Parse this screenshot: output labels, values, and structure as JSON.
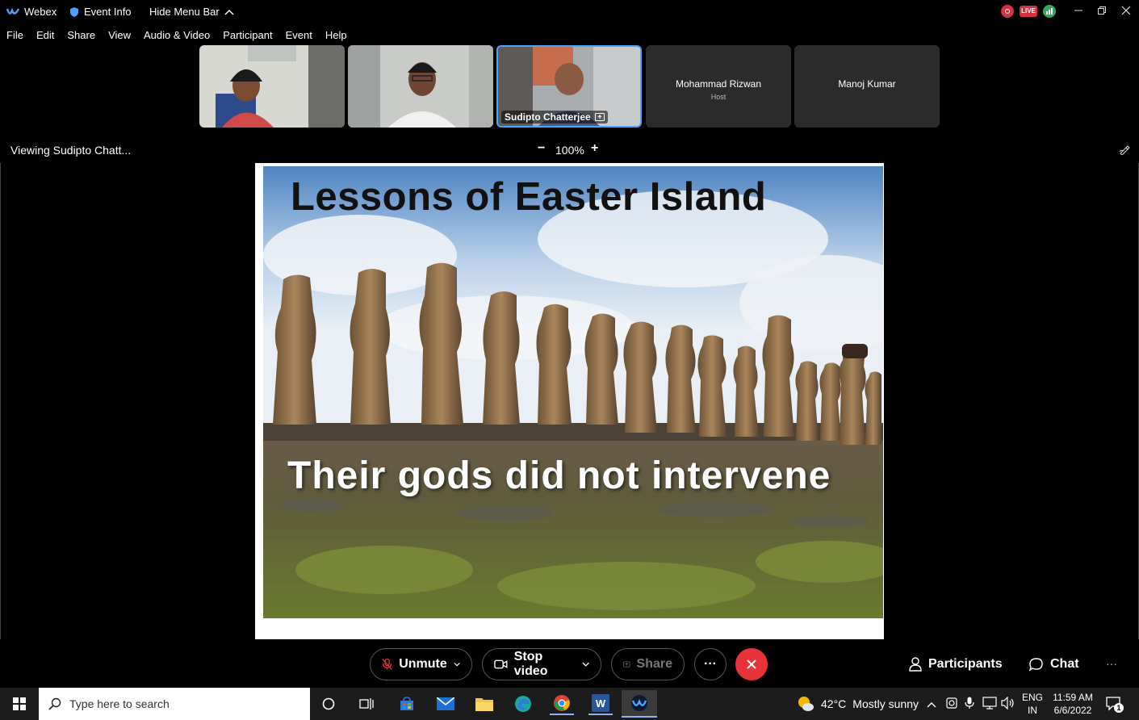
{
  "titlebar": {
    "app_name": "Webex",
    "event_info": "Event Info",
    "hide_menu": "Hide Menu Bar",
    "live_badge": "LIVE"
  },
  "menu": [
    "File",
    "Edit",
    "Share",
    "View",
    "Audio & Video",
    "Participant",
    "Event",
    "Help"
  ],
  "participants": [
    {
      "name": "",
      "type": "video"
    },
    {
      "name": "",
      "type": "video"
    },
    {
      "name": "Sudipto Chatterjee",
      "type": "video",
      "active": true
    },
    {
      "name": "Mohammad Rizwan",
      "role": "Host",
      "type": "avatar"
    },
    {
      "name": "Manoj Kumar",
      "type": "avatar"
    }
  ],
  "viewing": {
    "label": "Viewing Sudipto Chatt...",
    "zoom_minus": "−",
    "zoom": "100%",
    "zoom_plus": "+"
  },
  "slide": {
    "title": "Lessons of Easter Island",
    "caption": "Their gods did not intervene"
  },
  "controls": {
    "unmute": "Unmute",
    "stop_video": "Stop video",
    "share": "Share",
    "more": "···",
    "participants": "Participants",
    "chat": "Chat",
    "overflow": "···"
  },
  "taskbar": {
    "search_placeholder": "Type here to search",
    "weather_temp": "42°C",
    "weather_desc": "Mostly sunny",
    "lang_top": "ENG",
    "lang_bottom": "IN",
    "time": "11:59 AM",
    "date": "6/6/2022",
    "notif_count": "1"
  },
  "colors": {
    "accent_blue": "#4aa3ff",
    "end_red": "#e8333a",
    "live_red": "#d93040",
    "host_green": "#3aa55d"
  }
}
